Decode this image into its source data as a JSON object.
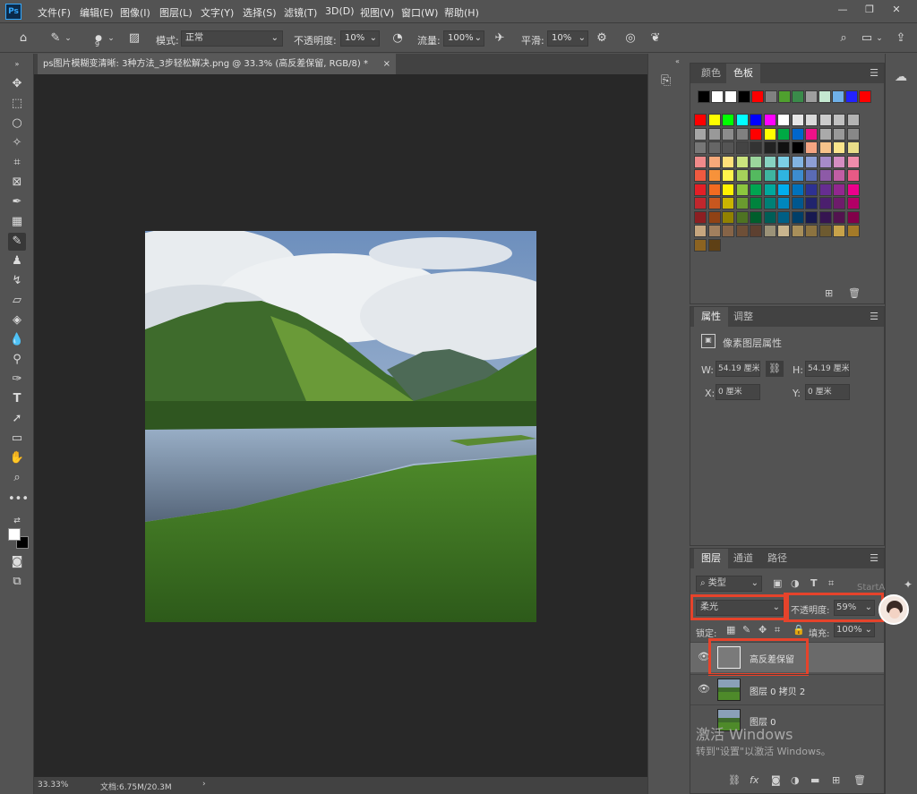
{
  "app": {
    "logo": "Ps"
  },
  "menu": [
    "文件(F)",
    "编辑(E)",
    "图像(I)",
    "图层(L)",
    "文字(Y)",
    "选择(S)",
    "滤镜(T)",
    "3D(D)",
    "视图(V)",
    "窗口(W)",
    "帮助(H)"
  ],
  "options": {
    "brush_size": "9",
    "mode_label": "模式:",
    "mode_value": "正常",
    "opacity_label": "不透明度:",
    "opacity_value": "10%",
    "flow_label": "流量:",
    "flow_value": "100%",
    "smoothing_label": "平滑:",
    "smoothing_value": "10%"
  },
  "document": {
    "tab_title": "ps图片模糊变清晰: 3种方法_3步轻松解决.png @ 33.3% (高反差保留, RGB/8) *",
    "zoom": "33.33%",
    "doc_info": "文档:6.75M/20.3M"
  },
  "swatches_panel": {
    "tab_color": "颜色",
    "tab_swatches": "色板",
    "basic_colors": [
      "#000000",
      "#ffffff",
      "#ffffff",
      "#000000",
      "#ff0000",
      "#808080",
      "#4fa02e",
      "#3a8b4a",
      "#9e9e9e",
      "#c4e8d0",
      "#6fb0e8",
      "#2222ff",
      "#ff0000"
    ],
    "grid_colors": [
      "#ff0000",
      "#ffff00",
      "#00ff00",
      "#00ffff",
      "#0000ff",
      "#ff00ff",
      "#ffffff",
      "#e6e6e6",
      "#d9d9d9",
      "#cccccc",
      "#c0c0c0",
      "#b3b3b3",
      "#a6a6a6",
      "#999999",
      "#8c8c8c",
      "#808080",
      "#ff0000",
      "#ffff00",
      "#00aa44",
      "#0066cc",
      "#ee1188",
      "#aaaaaa",
      "#999999",
      "#888888",
      "#777777",
      "#666666",
      "#555555",
      "#444444",
      "#333333",
      "#222222",
      "#111111",
      "#000000",
      "#f5a582",
      "#f7c38a",
      "#fbe58c",
      "#e8dd89",
      "#f08a8a",
      "#f6a97a",
      "#ffe07a",
      "#cbe47e",
      "#9bd59c",
      "#87d2c2",
      "#7ccfe6",
      "#82b4e2",
      "#8d9fd6",
      "#a68bc9",
      "#d48dc2",
      "#ef8cab",
      "#ef5a40",
      "#f7923a",
      "#fff44c",
      "#a6d25a",
      "#54b95f",
      "#3fb5a0",
      "#2fb4e0",
      "#3d8ccf",
      "#5a6bb5",
      "#8d5aa7",
      "#c05ea4",
      "#e85a85",
      "#e41f26",
      "#f26b21",
      "#fff200",
      "#8cc63e",
      "#00a551",
      "#00a99d",
      "#00aeef",
      "#0072bc",
      "#2e3192",
      "#662d91",
      "#92278f",
      "#ec008c",
      "#c1272d",
      "#c8571f",
      "#c9b400",
      "#6a9a2f",
      "#00833d",
      "#008076",
      "#0087bd",
      "#00578f",
      "#21246d",
      "#4b1f6e",
      "#6e1c6b",
      "#b30066",
      "#8c1f22",
      "#904215",
      "#918100",
      "#4e7322",
      "#005e2c",
      "#005e57",
      "#005f85",
      "#003f69",
      "#171950",
      "#361551",
      "#52134f",
      "#82004a",
      "#c7a67f",
      "#a17f5e",
      "#866447",
      "#6e4f37",
      "#5d4030",
      "#9b9278",
      "#c9b58e",
      "#a88f5a",
      "#8c7340",
      "#6d5a30",
      "#c7a24a",
      "#a47a28",
      "#8c6321",
      "#5e4015"
    ],
    "icons": [
      "new-swatch-icon",
      "trash-icon"
    ]
  },
  "properties_panel": {
    "tab_properties": "属性",
    "tab_adjustments": "调整",
    "section_title": "像素图层属性",
    "w_label": "W:",
    "w_value": "54.19 厘米",
    "h_label": "H:",
    "h_value": "54.19 厘米",
    "x_label": "X:",
    "x_value": "0 厘米",
    "y_label": "Y:",
    "y_value": "0 厘米"
  },
  "layers_panel": {
    "tab_layers": "图层",
    "tab_channels": "通道",
    "tab_paths": "路径",
    "filter_type": "类型",
    "blend_mode": "柔光",
    "opacity_label": "不透明度:",
    "opacity_value": "59%",
    "lock_label": "锁定:",
    "fill_label": "填充:",
    "fill_value": "100%",
    "layers": [
      {
        "name": "高反差保留",
        "selected": true
      },
      {
        "name": "图层 0 拷贝 2",
        "selected": false
      },
      {
        "name": "图层 0",
        "selected": false
      }
    ]
  },
  "overlay": {
    "startai": "StartAI",
    "watermark_title": "激活 Windows",
    "watermark_sub": "转到\"设置\"以激活 Windows。"
  }
}
